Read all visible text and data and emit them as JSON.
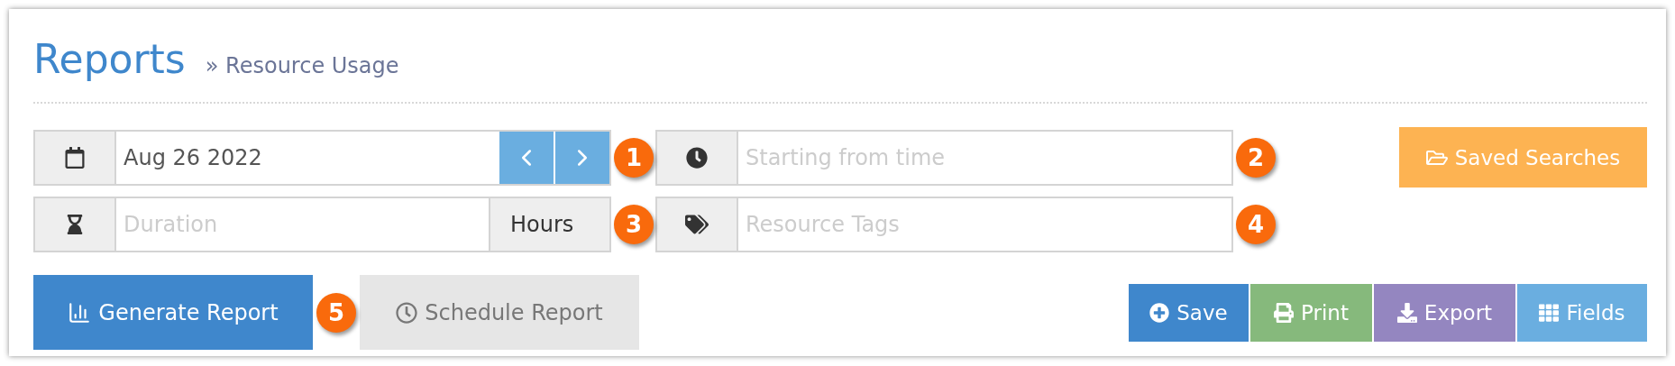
{
  "header": {
    "title": "Reports",
    "separator": "»",
    "subtitle": "Resource Usage"
  },
  "fields": [
    {
      "kind": "date",
      "value": "Aug 26 2022",
      "badge": "1"
    },
    {
      "kind": "time",
      "placeholder": "Starting from time",
      "badge": "2"
    },
    {
      "kind": "duration",
      "placeholder": "Duration",
      "unit": "Hours",
      "badge": "3"
    },
    {
      "kind": "tags",
      "placeholder": "Resource Tags",
      "badge": "4"
    }
  ],
  "saved_searches": {
    "label": "Saved Searches"
  },
  "left_actions": [
    {
      "kind": "generate",
      "label": "Generate Report",
      "badge": "5"
    },
    {
      "kind": "schedule",
      "label": "Schedule Report"
    }
  ],
  "right_actions": [
    {
      "kind": "save",
      "label": "Save"
    },
    {
      "kind": "print",
      "label": "Print"
    },
    {
      "kind": "export",
      "label": "Export"
    },
    {
      "kind": "fields",
      "label": "Fields"
    }
  ]
}
